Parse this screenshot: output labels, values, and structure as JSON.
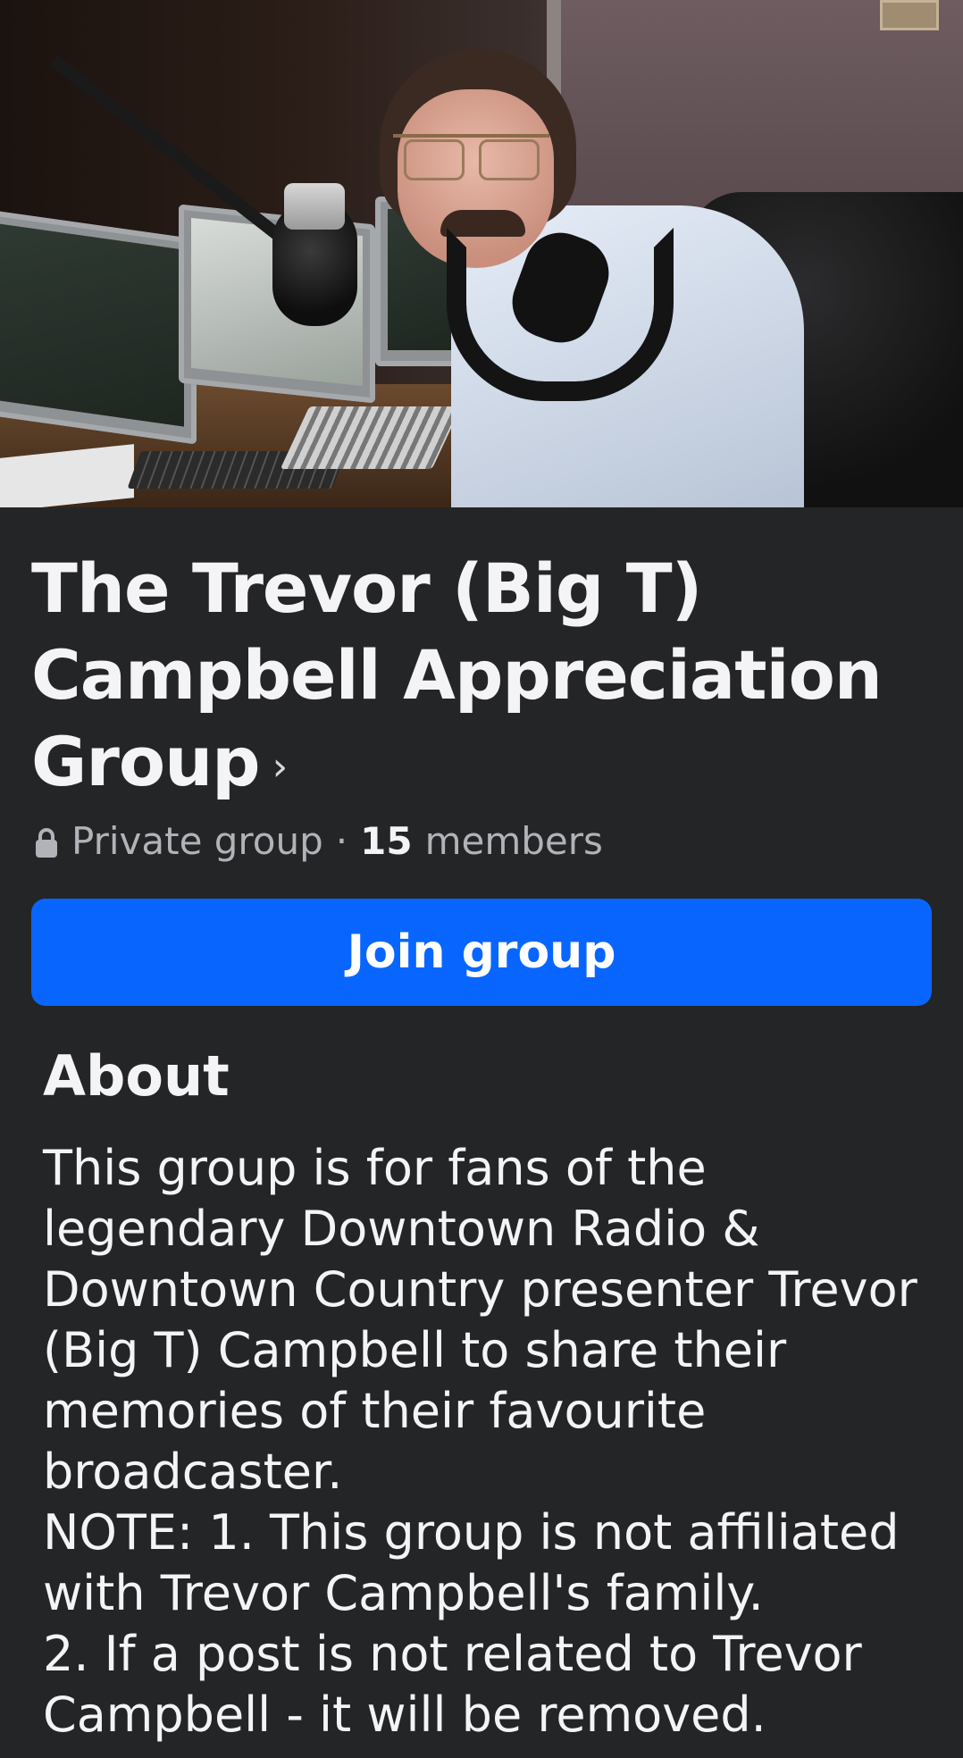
{
  "group": {
    "name": "The Trevor (Big T) Campbell Appreciation Group",
    "chevron": "›",
    "privacy": "Private group",
    "separator": "·",
    "member_count": "15",
    "members_label": "members",
    "join_label": "Join group"
  },
  "about": {
    "heading": "About",
    "description": "This group is for fans of the legendary Downtown Radio & Downtown Country presenter Trevor (Big T) Campbell to share their memories of their favourite broadcaster.\nNOTE: 1. This group is not affiliated with Trevor Campbell's family.\n2. If a post is not related to Trevor Campbell - it will be removed."
  },
  "icons": {
    "lock": "lock-icon",
    "chevron": "chevron-right-icon"
  },
  "colors": {
    "background": "#242526",
    "primary_button": "#0866ff",
    "text_primary": "#f4f4f6",
    "text_secondary": "#b0b3b8"
  }
}
